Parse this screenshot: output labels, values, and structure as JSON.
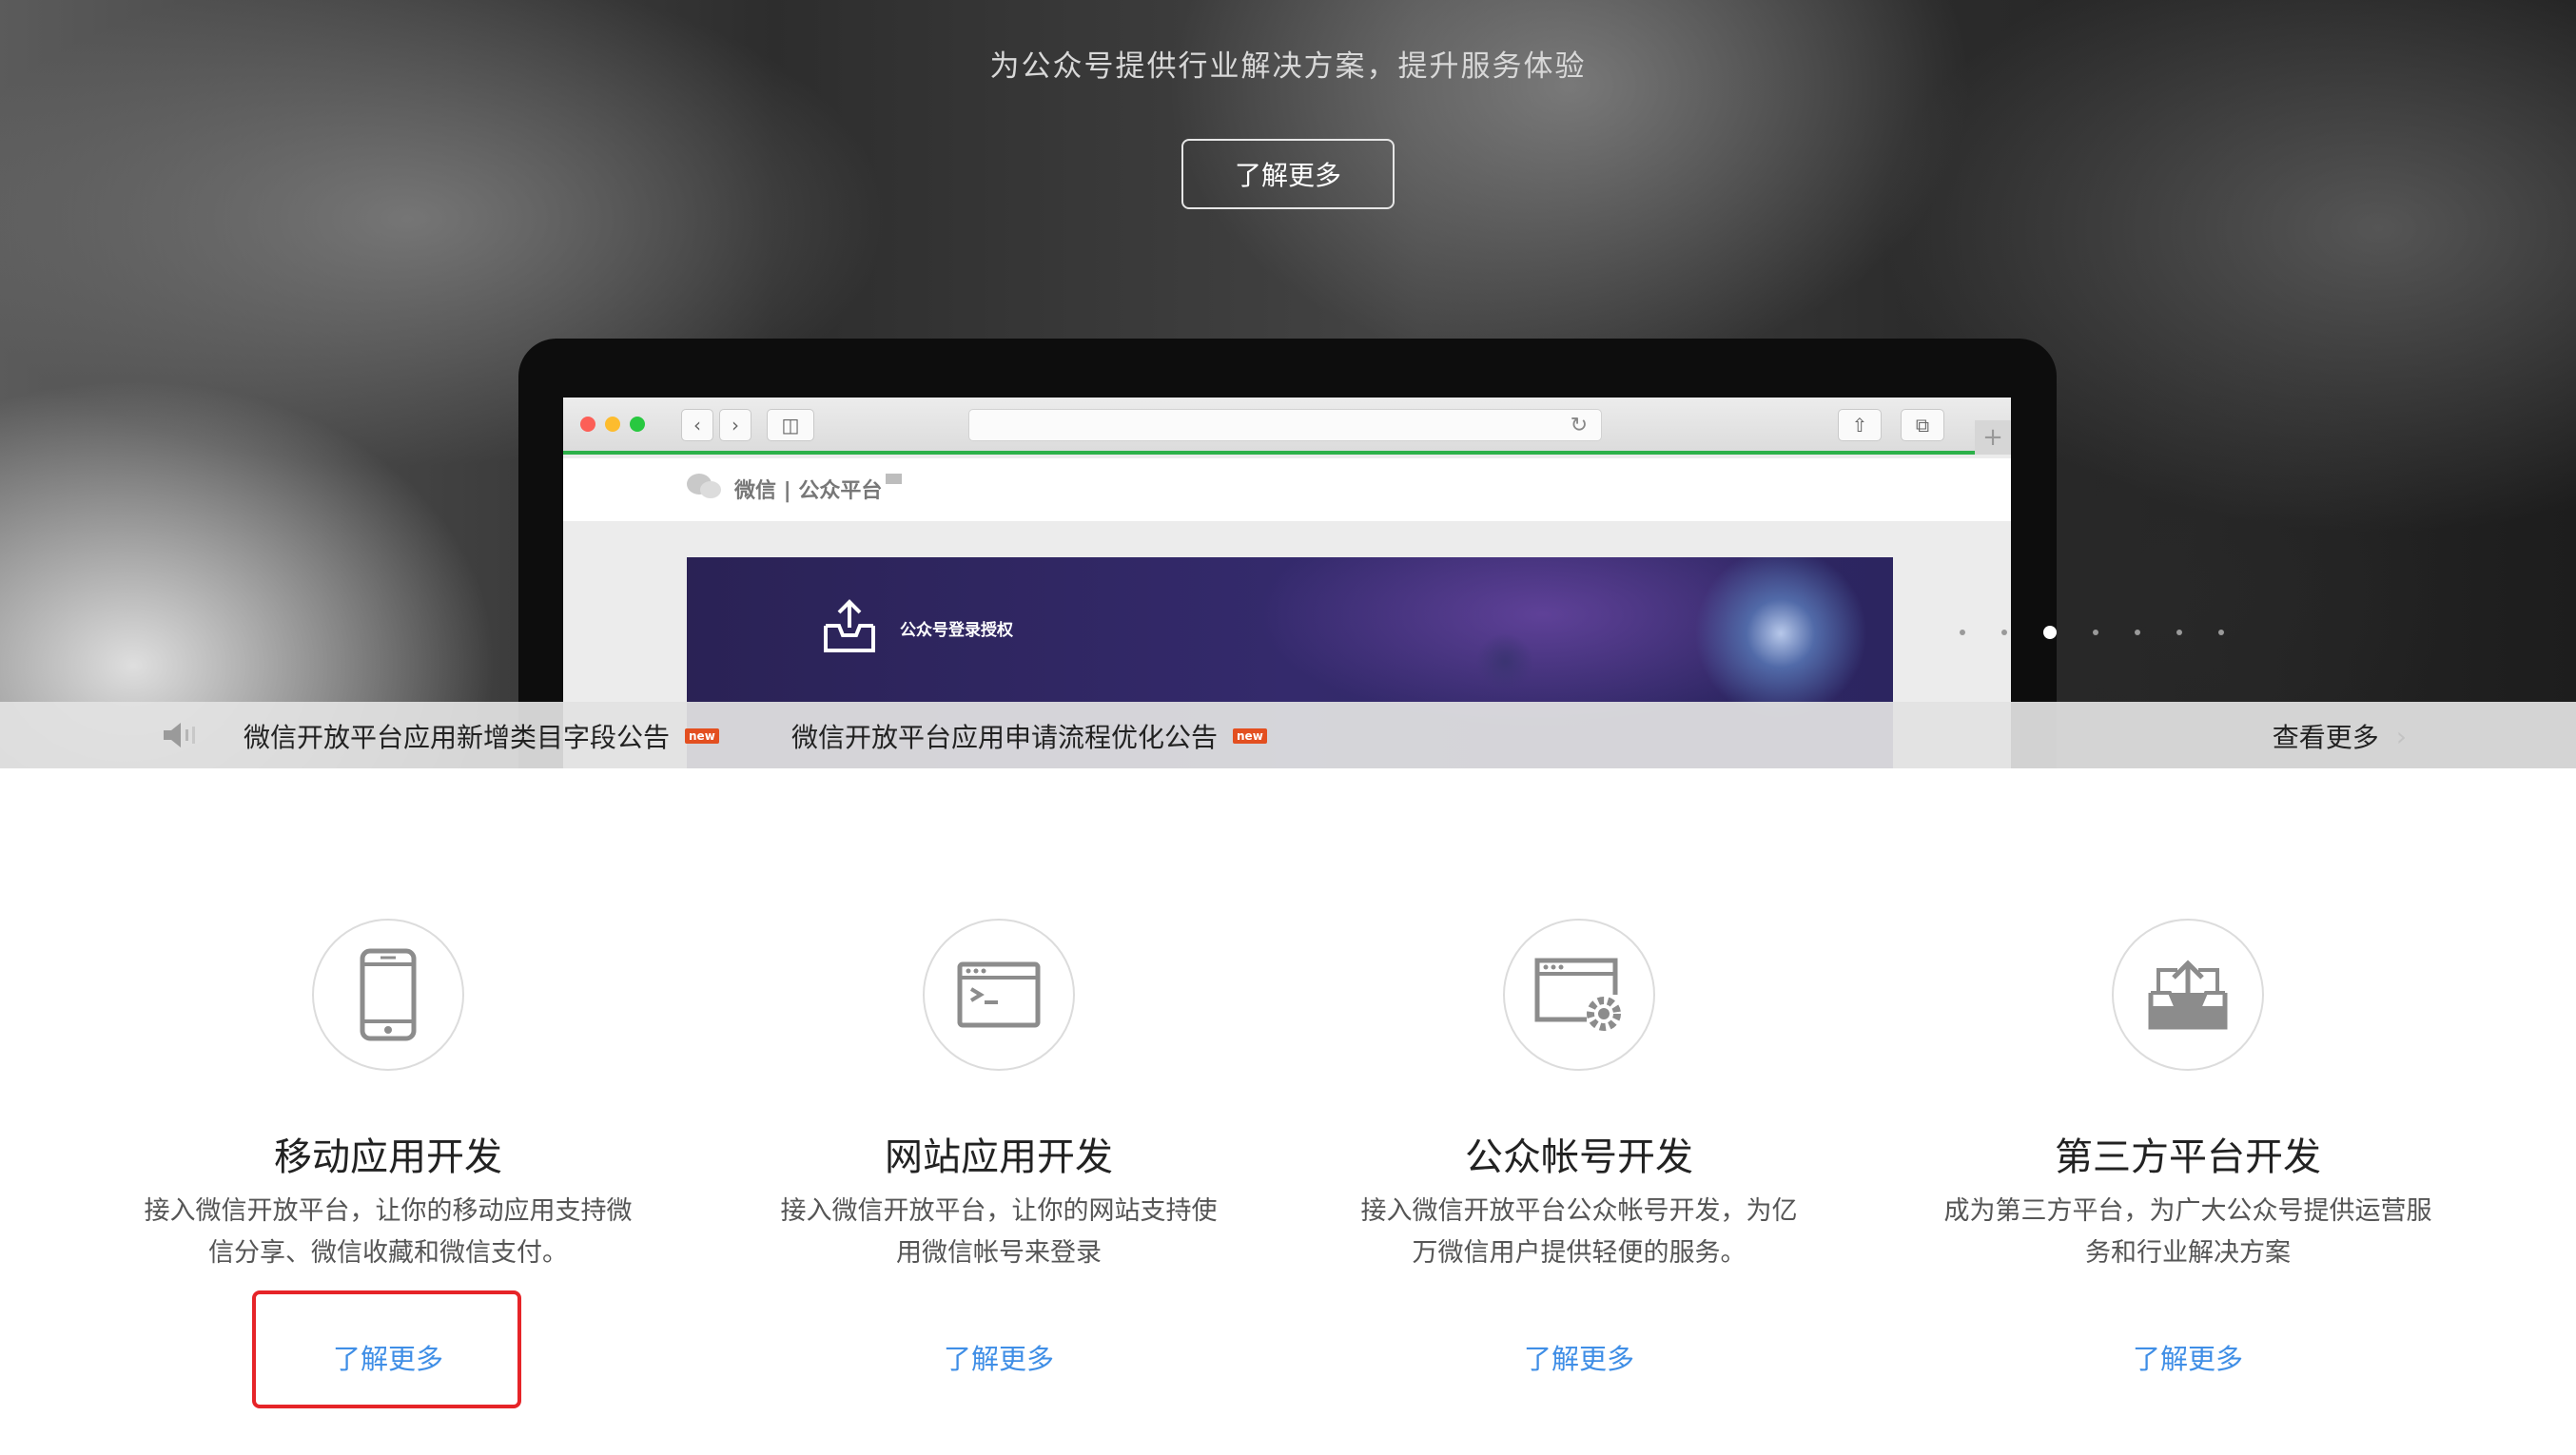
{
  "hero": {
    "subtitle": "为公众号提供行业解决方案，提升服务体验",
    "button_label": "了解更多",
    "carousel_active_index": 2,
    "carousel_count": 7
  },
  "browser": {
    "logo_text": "微信 | 公众平台",
    "banner_text": "公众号登录授权",
    "accent_color": "#2db14a"
  },
  "notices": {
    "items": [
      {
        "text": "微信开放平台应用新增类目字段公告",
        "badge": "new"
      },
      {
        "text": "微信开放平台应用申请流程优化公告",
        "badge": "new"
      }
    ],
    "more_label": "查看更多"
  },
  "features": [
    {
      "icon": "mobile-phone-icon",
      "title": "移动应用开发",
      "desc_line1": "接入微信开放平台，让你的移动应用支持微",
      "desc_line2": "信分享、微信收藏和微信支付。",
      "link": "了解更多"
    },
    {
      "icon": "website-terminal-icon",
      "title": "网站应用开发",
      "desc_line1": "接入微信开放平台，让你的网站支持使",
      "desc_line2": "用微信帐号来登录",
      "link": "了解更多"
    },
    {
      "icon": "window-gear-icon",
      "title": "公众帐号开发",
      "desc_line1": "接入微信开放平台公众帐号开发，为亿",
      "desc_line2": "万微信用户提供轻便的服务。",
      "link": "了解更多"
    },
    {
      "icon": "inbox-upload-icon",
      "title": "第三方平台开发",
      "desc_line1": "成为第三方平台，为广大公众号提供运营服",
      "desc_line2": "务和行业解决方案",
      "link": "了解更多"
    }
  ],
  "colors": {
    "link": "#3f8ee6",
    "highlight": "#e62428",
    "new_badge": "#e34f20"
  }
}
